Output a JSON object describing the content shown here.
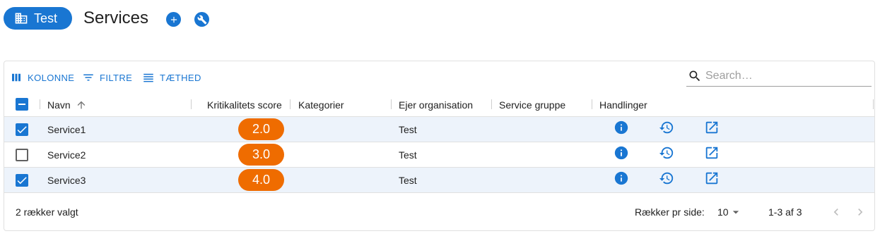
{
  "header": {
    "org_chip_label": "Test",
    "page_title": "Services"
  },
  "toolbar": {
    "columns_label": "KOLONNE",
    "filters_label": "FILTRE",
    "density_label": "TÆTHED",
    "search_placeholder": "Search…"
  },
  "table": {
    "columns": [
      "Navn",
      "Kritikalitets score",
      "Kategorier",
      "Ejer organisation",
      "Service gruppe",
      "Handlinger"
    ],
    "rows": [
      {
        "selected": true,
        "name": "Service1",
        "score": "2.0",
        "categories": "",
        "owner": "Test",
        "group": ""
      },
      {
        "selected": false,
        "name": "Service2",
        "score": "3.0",
        "categories": "",
        "owner": "Test",
        "group": ""
      },
      {
        "selected": true,
        "name": "Service3",
        "score": "4.0",
        "categories": "",
        "owner": "Test",
        "group": ""
      }
    ]
  },
  "footer": {
    "selected_text": "2 rækker valgt",
    "rows_per_page_label": "Rækker pr side:",
    "rows_per_page_value": "10",
    "range_text": "1-3 af 3"
  },
  "colors": {
    "primary": "#1976d2",
    "score_pill": "#ef6c00",
    "selected_row": "#edf3fb"
  },
  "icons": {
    "org": "domain-icon",
    "add": "add-circle-icon",
    "settings": "wrench-icon",
    "columns": "view-column-icon",
    "filters": "filter-list-icon",
    "density": "density-icon",
    "search": "search-icon",
    "sort": "arrow-upward-icon",
    "info": "info-icon",
    "history": "history-icon",
    "open": "open-in-new-icon"
  }
}
